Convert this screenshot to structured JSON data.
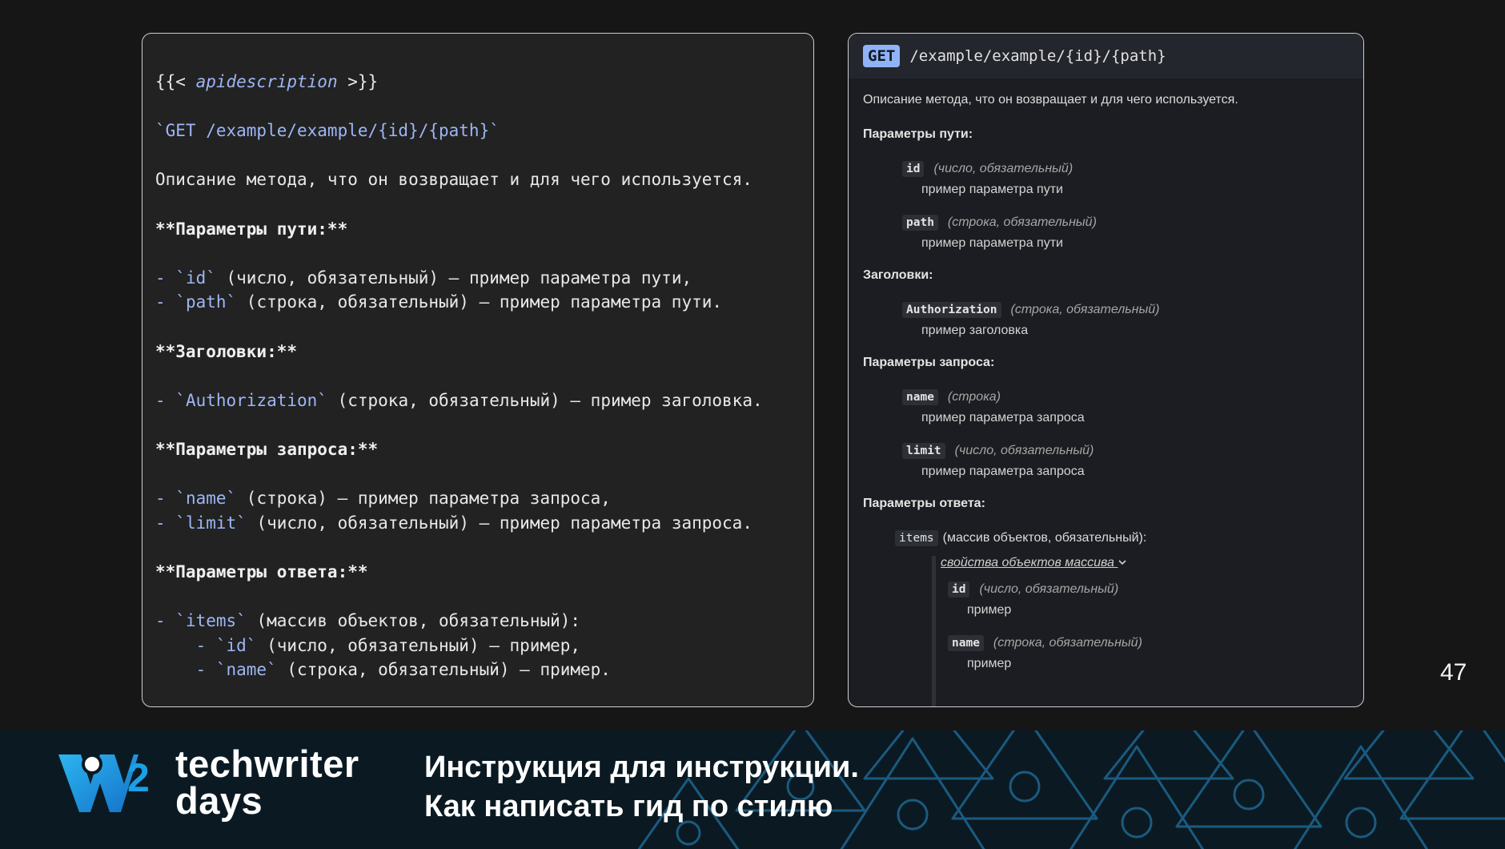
{
  "code_panel": {
    "line1": {
      "open": "{{< ",
      "shortcode": "apidescription",
      "close": " >}}"
    },
    "line2": "`GET /example/example/{id}/{path}`",
    "line3": "Описание метода, что он возвращает и для чего используется.",
    "path_heading": "**Параметры пути:**",
    "path_items": [
      {
        "dash": "- ",
        "code": "`id`",
        "text": " (число, обязательный) — пример параметра пути,"
      },
      {
        "dash": "- ",
        "code": "`path`",
        "text": " (строка, обязательный) — пример параметра пути."
      }
    ],
    "headers_heading": "**Заголовки:**",
    "header_items": [
      {
        "dash": "- ",
        "code": "`Authorization`",
        "text": " (строка, обязательный) — пример заголовка."
      }
    ],
    "query_heading": "**Параметры запроса:**",
    "query_items": [
      {
        "dash": "- ",
        "code": "`name`",
        "text": " (строка) — пример параметра запроса,"
      },
      {
        "dash": "- ",
        "code": "`limit`",
        "text": " (число, обязательный) — пример параметра запроса."
      }
    ],
    "response_heading": "**Параметры ответа:**",
    "response_items": [
      {
        "dash": "- ",
        "code": "`items`",
        "text": " (массив объектов, обязательный):"
      },
      {
        "dash": "    - ",
        "code": "`id`",
        "text": " (число, обязательный) — пример,"
      },
      {
        "dash": "    - ",
        "code": "`name`",
        "text": " (строка, обязательный) — пример."
      }
    ]
  },
  "preview_panel": {
    "method": "GET",
    "path": "/example/example/{id}/{path}",
    "description": "Описание метода, что он возвращает и для чего используется.",
    "sections": {
      "path_title": "Параметры пути:",
      "path_params": [
        {
          "name": "id",
          "meta": "(число, обязательный)",
          "desc": "пример параметра пути"
        },
        {
          "name": "path",
          "meta": "(строка, обязательный)",
          "desc": "пример параметра пути"
        }
      ],
      "headers_title": "Заголовки:",
      "headers": [
        {
          "name": "Authorization",
          "meta": "(строка, обязательный)",
          "desc": "пример заголовка"
        }
      ],
      "query_title": "Параметры запроса:",
      "query_params": [
        {
          "name": "name",
          "meta": "(строка)",
          "desc": "пример параметра запроса"
        },
        {
          "name": "limit",
          "meta": "(число, обязательный)",
          "desc": "пример параметра запроса"
        }
      ],
      "response_title": "Параметры ответа:",
      "response_item": {
        "name": "items",
        "text": "(массив объектов, обязательный):"
      },
      "nested_toggle": "свойства объектов массива",
      "nested": [
        {
          "name": "id",
          "meta": "(число, обязательный)",
          "desc": "пример"
        },
        {
          "name": "name",
          "meta": "(строка, обязательный)",
          "desc": "пример"
        }
      ]
    }
  },
  "page_number": "47",
  "banner": {
    "brand_line1": "techwriter",
    "brand_line2": "days",
    "logo_digit": "2",
    "title_line1": "Инструкция для инструкции.",
    "title_line2": "Как написать гид по стилю"
  },
  "colors": {
    "background": "#161616",
    "code_accent": "#9db6f5",
    "method_badge": "#8fb3f6",
    "banner_bg": "#0b1a22",
    "logo_blue": "#1aa0e6"
  }
}
